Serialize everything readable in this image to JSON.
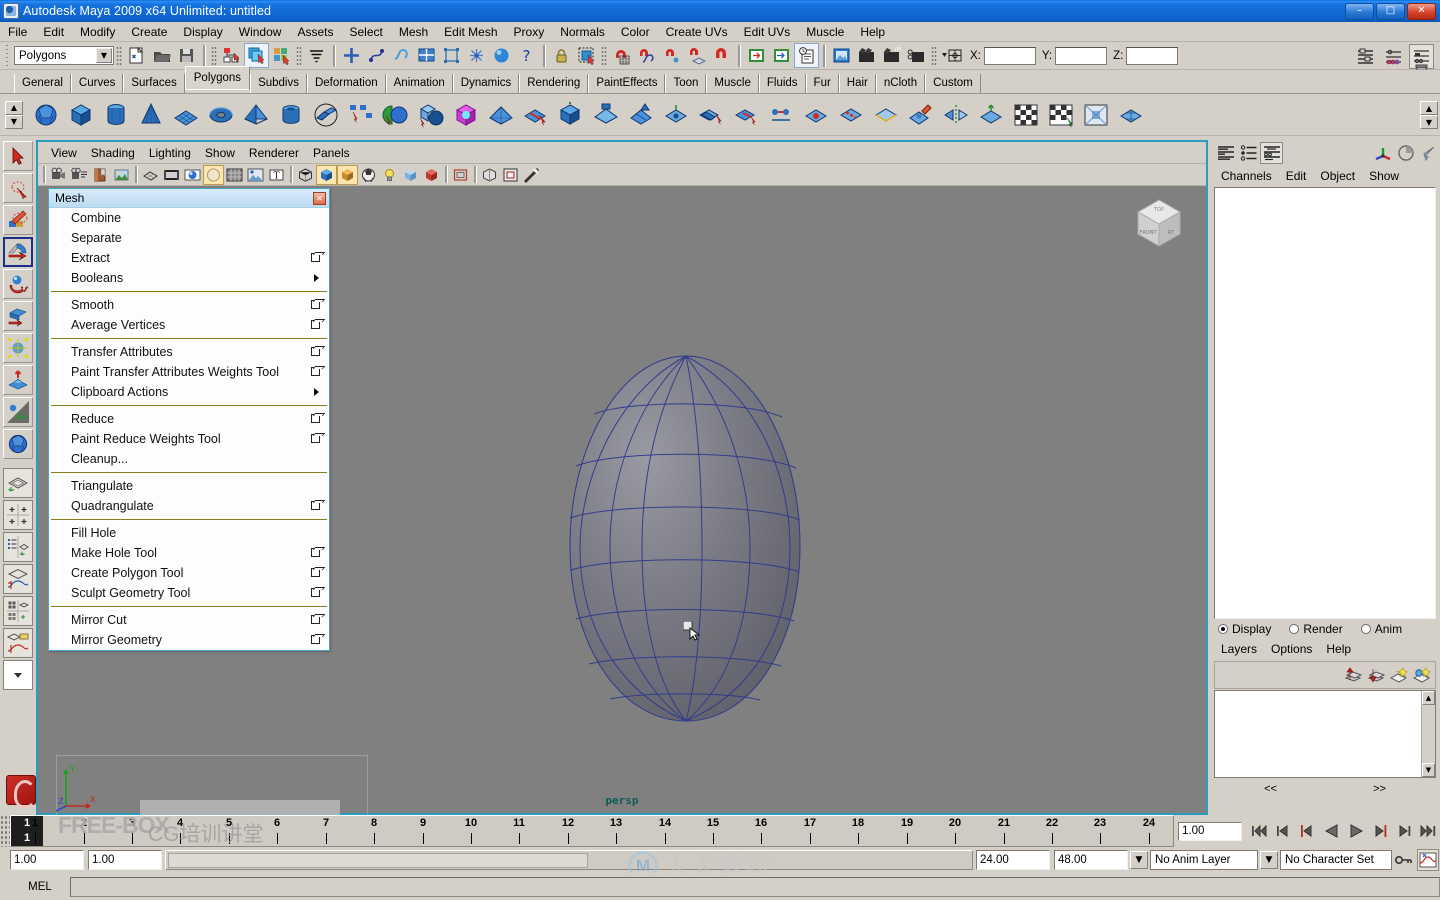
{
  "window": {
    "title": "Autodesk Maya 2009 x64 Unlimited: untitled",
    "icon": "maya-app-icon",
    "minimize": "–",
    "maximize": "□",
    "close": "✕"
  },
  "menubar": {
    "items": [
      "File",
      "Edit",
      "Modify",
      "Create",
      "Display",
      "Window",
      "Assets",
      "Select",
      "Mesh",
      "Edit Mesh",
      "Proxy",
      "Normals",
      "Color",
      "Create UVs",
      "Edit UVs",
      "Muscle",
      "Help"
    ]
  },
  "statusline": {
    "menuset": "Polygons",
    "coord_labels": [
      "X:",
      "Y:",
      "Z:"
    ],
    "coord_values": [
      "",
      "",
      ""
    ],
    "icons": [
      "new-scene-icon",
      "open-scene-icon",
      "save-scene-icon",
      "select-by-hierarchy-icon",
      "select-by-object-type-icon",
      "select-by-component-type-icon",
      "select-mask-icon",
      "snap-to-grid-icon",
      "snap-to-curve-icon",
      "snap-to-point-icon",
      "snap-to-view-plane-icon",
      "snap-to-live-icon",
      "construction-history-icon",
      "help-icon",
      "lock-icon",
      "selection-highlight-icon",
      "magnet-grid-icon",
      "magnet-curve-icon",
      "magnet-point-icon",
      "magnet-plane-icon",
      "magnet-live-icon",
      "input-connections-icon",
      "output-connections-icon",
      "attribute-editor-history-icon",
      "render-view-icon",
      "render-current-frame-icon",
      "ipr-render-icon",
      "render-settings-icon",
      "show-manipulator-icon"
    ],
    "right_icons": [
      "show-hide-attribute-editor-icon",
      "show-hide-tool-settings-icon",
      "show-hide-channel-box-icon",
      "trash-icon"
    ]
  },
  "shelf": {
    "tabs": [
      "General",
      "Curves",
      "Surfaces",
      "Polygons",
      "Subdivs",
      "Deformation",
      "Animation",
      "Dynamics",
      "Rendering",
      "PaintEffects",
      "Toon",
      "Muscle",
      "Fluids",
      "Fur",
      "Hair",
      "nCloth",
      "Custom"
    ],
    "selected_tab": "Polygons",
    "buttons": [
      "poly-sphere-icon",
      "poly-cube-icon",
      "poly-cylinder-icon",
      "poly-cone-icon",
      "poly-plane-icon",
      "poly-torus-icon",
      "poly-pyramid-icon",
      "poly-pipe-icon",
      "poly-soccer-ball-icon",
      "poly-combine-icon",
      "poly-separate-icon",
      "poly-booleans-icon",
      "poly-smooth-proxy-icon",
      "poly-extrude-icon",
      "poly-split-icon",
      "poly-append-icon",
      "poly-bevel-icon",
      "poly-wedge-icon",
      "poly-poke-icon",
      "poly-duplicate-face-icon",
      "poly-extract-icon",
      "poly-merge-icon",
      "poly-collapse-icon",
      "poly-delete-edge-icon",
      "poly-crease-icon",
      "poly-sculpt-geometry-icon",
      "poly-mirror-icon",
      "poly-normals-icon",
      "poly-uv-checker-icon",
      "poly-uv-planar-icon",
      "poly-uv-editor-icon",
      "poly-quadrangulate-icon"
    ]
  },
  "toolbox": {
    "tools": [
      {
        "name": "select-tool",
        "label": "Select Tool"
      },
      {
        "name": "lasso-select-tool",
        "label": "Lasso Select Tool"
      },
      {
        "name": "paint-select-tool",
        "label": "Paint Selection Tool"
      },
      {
        "name": "move-tool",
        "label": "Move Tool",
        "selected": true
      },
      {
        "name": "rotate-tool",
        "label": "Rotate Tool"
      },
      {
        "name": "scale-tool",
        "label": "Scale Tool"
      },
      {
        "name": "universal-manipulator-tool",
        "label": "Universal Manipulator"
      },
      {
        "name": "soft-modification-tool",
        "label": "Soft Modification Tool"
      },
      {
        "name": "show-manipulator-tool",
        "label": "Show Manipulator Tool"
      },
      {
        "name": "last-tool-used",
        "label": "Last Tool Used"
      }
    ],
    "layouts": [
      {
        "name": "single-perspective-layout",
        "label": "Single Perspective View"
      },
      {
        "name": "four-view-layout",
        "label": "Four View"
      },
      {
        "name": "outliner-persp-layout",
        "label": "Outliner / Persp"
      },
      {
        "name": "persp-graph-layout",
        "label": "Persp / Graph Editor"
      },
      {
        "name": "hypershade-persp-layout",
        "label": "Hypershade / Persp"
      },
      {
        "name": "persp-trax-layout",
        "label": "Persp / Trax"
      },
      {
        "name": "layout-more",
        "label": "More Layouts"
      }
    ]
  },
  "viewport": {
    "menus": [
      "View",
      "Shading",
      "Lighting",
      "Show",
      "Renderer",
      "Panels"
    ],
    "camera_label": "persp",
    "toolbar_icons": [
      "select-camera-icon",
      "camera-attributes-icon",
      "bookmarks-icon",
      "image-plane-icon",
      "wireframe-icon",
      "smooth-shade-all-icon",
      "smooth-shade-selected-icon",
      "hardware-texturing-icon",
      "wireframe-on-shaded-icon",
      "hardware-lighting-icon",
      "xray-icon",
      "isolate-select-icon",
      "shaded-cube-icon",
      "textured-cube-icon",
      "ball-shading-icon",
      "use-all-lights-icon",
      "shadows-icon",
      "occlusion-icon",
      "object-xray-icon",
      "ipr-render-icon",
      "render-region-icon",
      "exposure-icon"
    ],
    "view_cube_labels": [
      "TOP",
      "FRONT",
      "RIGHT"
    ],
    "object": {
      "name": "poly-egg-mesh",
      "wireframe_color": "#2e3a8c",
      "shade_color": "#6f6f78"
    }
  },
  "mesh_menu": {
    "title": "Mesh",
    "close": "✕",
    "groups": [
      [
        {
          "label": "Combine",
          "option": false,
          "submenu": false
        },
        {
          "label": "Separate",
          "option": false,
          "submenu": false
        },
        {
          "label": "Extract",
          "option": true,
          "submenu": false
        },
        {
          "label": "Booleans",
          "option": false,
          "submenu": true
        }
      ],
      [
        {
          "label": "Smooth",
          "option": true,
          "submenu": false
        },
        {
          "label": "Average Vertices",
          "option": true,
          "submenu": false
        }
      ],
      [
        {
          "label": "Transfer Attributes",
          "option": true,
          "submenu": false
        },
        {
          "label": "Paint Transfer Attributes Weights Tool",
          "option": true,
          "submenu": false
        },
        {
          "label": "Clipboard Actions",
          "option": false,
          "submenu": true
        }
      ],
      [
        {
          "label": "Reduce",
          "option": true,
          "submenu": false
        },
        {
          "label": "Paint Reduce Weights Tool",
          "option": true,
          "submenu": false
        },
        {
          "label": "Cleanup...",
          "option": false,
          "submenu": false
        }
      ],
      [
        {
          "label": "Triangulate",
          "option": false,
          "submenu": false
        },
        {
          "label": "Quadrangulate",
          "option": true,
          "submenu": false
        }
      ],
      [
        {
          "label": "Fill Hole",
          "option": false,
          "submenu": false
        },
        {
          "label": "Make Hole Tool",
          "option": true,
          "submenu": false
        },
        {
          "label": "Create Polygon Tool",
          "option": true,
          "submenu": false
        },
        {
          "label": "Sculpt Geometry Tool",
          "option": true,
          "submenu": false
        }
      ],
      [
        {
          "label": "Mirror Cut",
          "option": true,
          "submenu": false
        },
        {
          "label": "Mirror Geometry",
          "option": true,
          "submenu": false
        }
      ]
    ]
  },
  "right_panel": {
    "top_icons": [
      "channel-box-icon",
      "attribute-editor-icon",
      "channel-box-layer-editor-icon"
    ],
    "top_right_icons": [
      "manipulator-axes-icon",
      "pie-toggle-icon",
      "arrow-tool-icon"
    ],
    "channel_menus": [
      "Channels",
      "Edit",
      "Object",
      "Show"
    ],
    "channel_rows": [],
    "layer_radios": [
      {
        "label": "Display",
        "selected": true
      },
      {
        "label": "Render",
        "selected": false
      },
      {
        "label": "Anim",
        "selected": false
      }
    ],
    "layer_menus": [
      "Layers",
      "Options",
      "Help"
    ],
    "layer_buttons": [
      "move-layer-up-icon",
      "move-layer-down-icon",
      "new-layer-icon",
      "new-layer-from-selected-icon"
    ],
    "pager_left": "<<",
    "pager_right": ">>"
  },
  "timeline": {
    "current_frame": "1",
    "ticks": [
      "1",
      "2",
      "3",
      "4",
      "5",
      "6",
      "7",
      "8",
      "9",
      "10",
      "11",
      "12",
      "13",
      "14",
      "15",
      "16",
      "17",
      "18",
      "19",
      "20",
      "21",
      "22",
      "23",
      "24"
    ],
    "frame_field": "1.00",
    "playback_buttons": [
      "go-to-start-icon",
      "step-back-keyframe-icon",
      "step-back-frame-icon",
      "play-backwards-icon",
      "play-forwards-icon",
      "step-forward-frame-icon",
      "step-forward-keyframe-icon",
      "go-to-end-icon"
    ],
    "range_start": "1.00",
    "range_start2": "1.00",
    "range_end": "24.00",
    "range_end2": "48.00",
    "anim_layer": "No Anim Layer",
    "character_set": "No Character Set",
    "auto_key": "auto-key-icon",
    "anim_prefs": "animation-preferences-icon"
  },
  "command_line": {
    "mel_label": "MEL",
    "input_value": ""
  },
  "watermark": {
    "freebox": "FREE-BOX",
    "cg_text": "CG培训讲堂",
    "rr_text": "人人素材"
  }
}
